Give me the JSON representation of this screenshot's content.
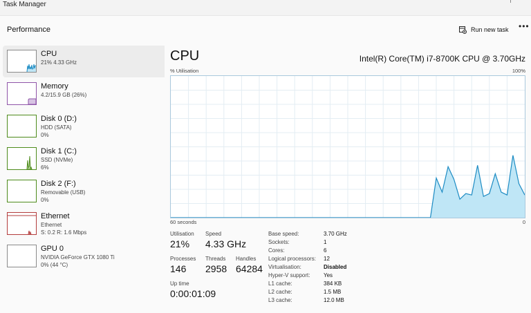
{
  "window": {
    "title": "Task Manager"
  },
  "header": {
    "section": "Performance",
    "run_new_task": "Run new task",
    "more": "•••"
  },
  "sidebar": {
    "items": [
      {
        "name": "CPU",
        "line1": "21%  4.33 GHz",
        "line2": "",
        "active": true
      },
      {
        "name": "Memory",
        "line1": "4.2/15.9 GB (26%)",
        "line2": ""
      },
      {
        "name": "Disk 0 (D:)",
        "line1": "HDD (SATA)",
        "line2": "0%"
      },
      {
        "name": "Disk 1 (C:)",
        "line1": "SSD (NVMe)",
        "line2": "6%"
      },
      {
        "name": "Disk 2 (F:)",
        "line1": "Removable (USB)",
        "line2": "0%"
      },
      {
        "name": "Ethernet",
        "line1": "Ethernet",
        "line2": "S: 0.2  R: 1.6 Mbps"
      },
      {
        "name": "GPU 0",
        "line1": "NVIDIA GeForce GTX 1080 Ti",
        "line2": "0% (44 °C)"
      }
    ]
  },
  "main": {
    "title": "CPU",
    "cpu_name": "Intel(R) Core(TM) i7-8700K CPU @ 3.70GHz",
    "util_label": "% Utilisation",
    "max_label": "100%",
    "seconds_label": "60 seconds",
    "zero_label": "0",
    "stats": {
      "utilisation_label": "Utilisation",
      "utilisation_value": "21%",
      "speed_label": "Speed",
      "speed_value": "4.33 GHz",
      "processes_label": "Processes",
      "processes_value": "146",
      "threads_label": "Threads",
      "threads_value": "2958",
      "handles_label": "Handles",
      "handles_value": "64284",
      "uptime_label": "Up time",
      "uptime_value": "0:00:01:09"
    },
    "specs": [
      {
        "label": "Base speed:",
        "value": "3.70 GHz"
      },
      {
        "label": "Sockets:",
        "value": "1"
      },
      {
        "label": "Cores:",
        "value": "6"
      },
      {
        "label": "Logical processors:",
        "value": "12"
      },
      {
        "label": "Virtualisation:",
        "value": "Disabled"
      },
      {
        "label": "Hyper-V support:",
        "value": "Yes"
      },
      {
        "label": "L1 cache:",
        "value": "384 KB"
      },
      {
        "label": "L2 cache:",
        "value": "1.5 MB"
      },
      {
        "label": "L3 cache:",
        "value": "12.0 MB"
      }
    ]
  },
  "colors": {
    "cpu_line": "#1c8bc3",
    "cpu_fill": "#bfe6f6",
    "grid": "#e3edf3",
    "memory": "#8f54a8",
    "disk": "#4d8b1a",
    "ethernet": "#b33c3c"
  },
  "chart_data": {
    "type": "area",
    "xlabel": "60 seconds",
    "ylabel": "% Utilisation",
    "ylim": [
      0,
      100
    ],
    "x": [
      0,
      2,
      4,
      6,
      8,
      10,
      12,
      14,
      16,
      18,
      20,
      22,
      24,
      26,
      28,
      30,
      32,
      34,
      36,
      38,
      40,
      42,
      44,
      45,
      46,
      47,
      48,
      49,
      50,
      51,
      52,
      53,
      54,
      55,
      56,
      57,
      58,
      59,
      60
    ],
    "values": [
      0,
      0,
      0,
      0,
      0,
      0,
      0,
      0,
      0,
      0,
      0,
      0,
      0,
      0,
      0,
      0,
      0,
      0,
      0,
      0,
      0,
      0,
      0,
      28,
      18,
      36,
      27,
      13,
      17,
      16,
      37,
      15,
      17,
      31,
      18,
      16,
      44,
      24,
      16
    ]
  }
}
